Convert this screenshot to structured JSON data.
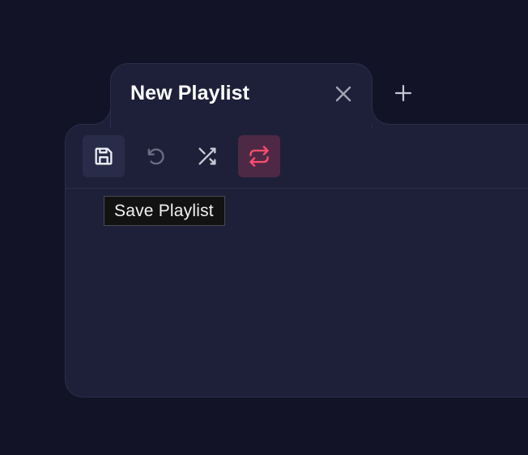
{
  "tab": {
    "title": "New Playlist",
    "close_icon": "close-icon",
    "new_tab_icon": "plus-icon"
  },
  "toolbar": {
    "buttons": [
      {
        "name": "save",
        "icon": "save-icon",
        "state": "hover"
      },
      {
        "name": "undo",
        "icon": "undo-icon",
        "state": "disabled"
      },
      {
        "name": "shuffle",
        "icon": "shuffle-icon",
        "state": "normal"
      },
      {
        "name": "repeat",
        "icon": "repeat-icon",
        "state": "active"
      }
    ]
  },
  "tooltip": {
    "text": "Save Playlist"
  },
  "colors": {
    "background": "#121326",
    "panel": "#1e2039",
    "border": "#2b2e4a",
    "accent": "#ff4d6d",
    "accent_bg": "#4e2945",
    "icon": "#e8e8f0",
    "icon_disabled": "#6b6d83"
  }
}
